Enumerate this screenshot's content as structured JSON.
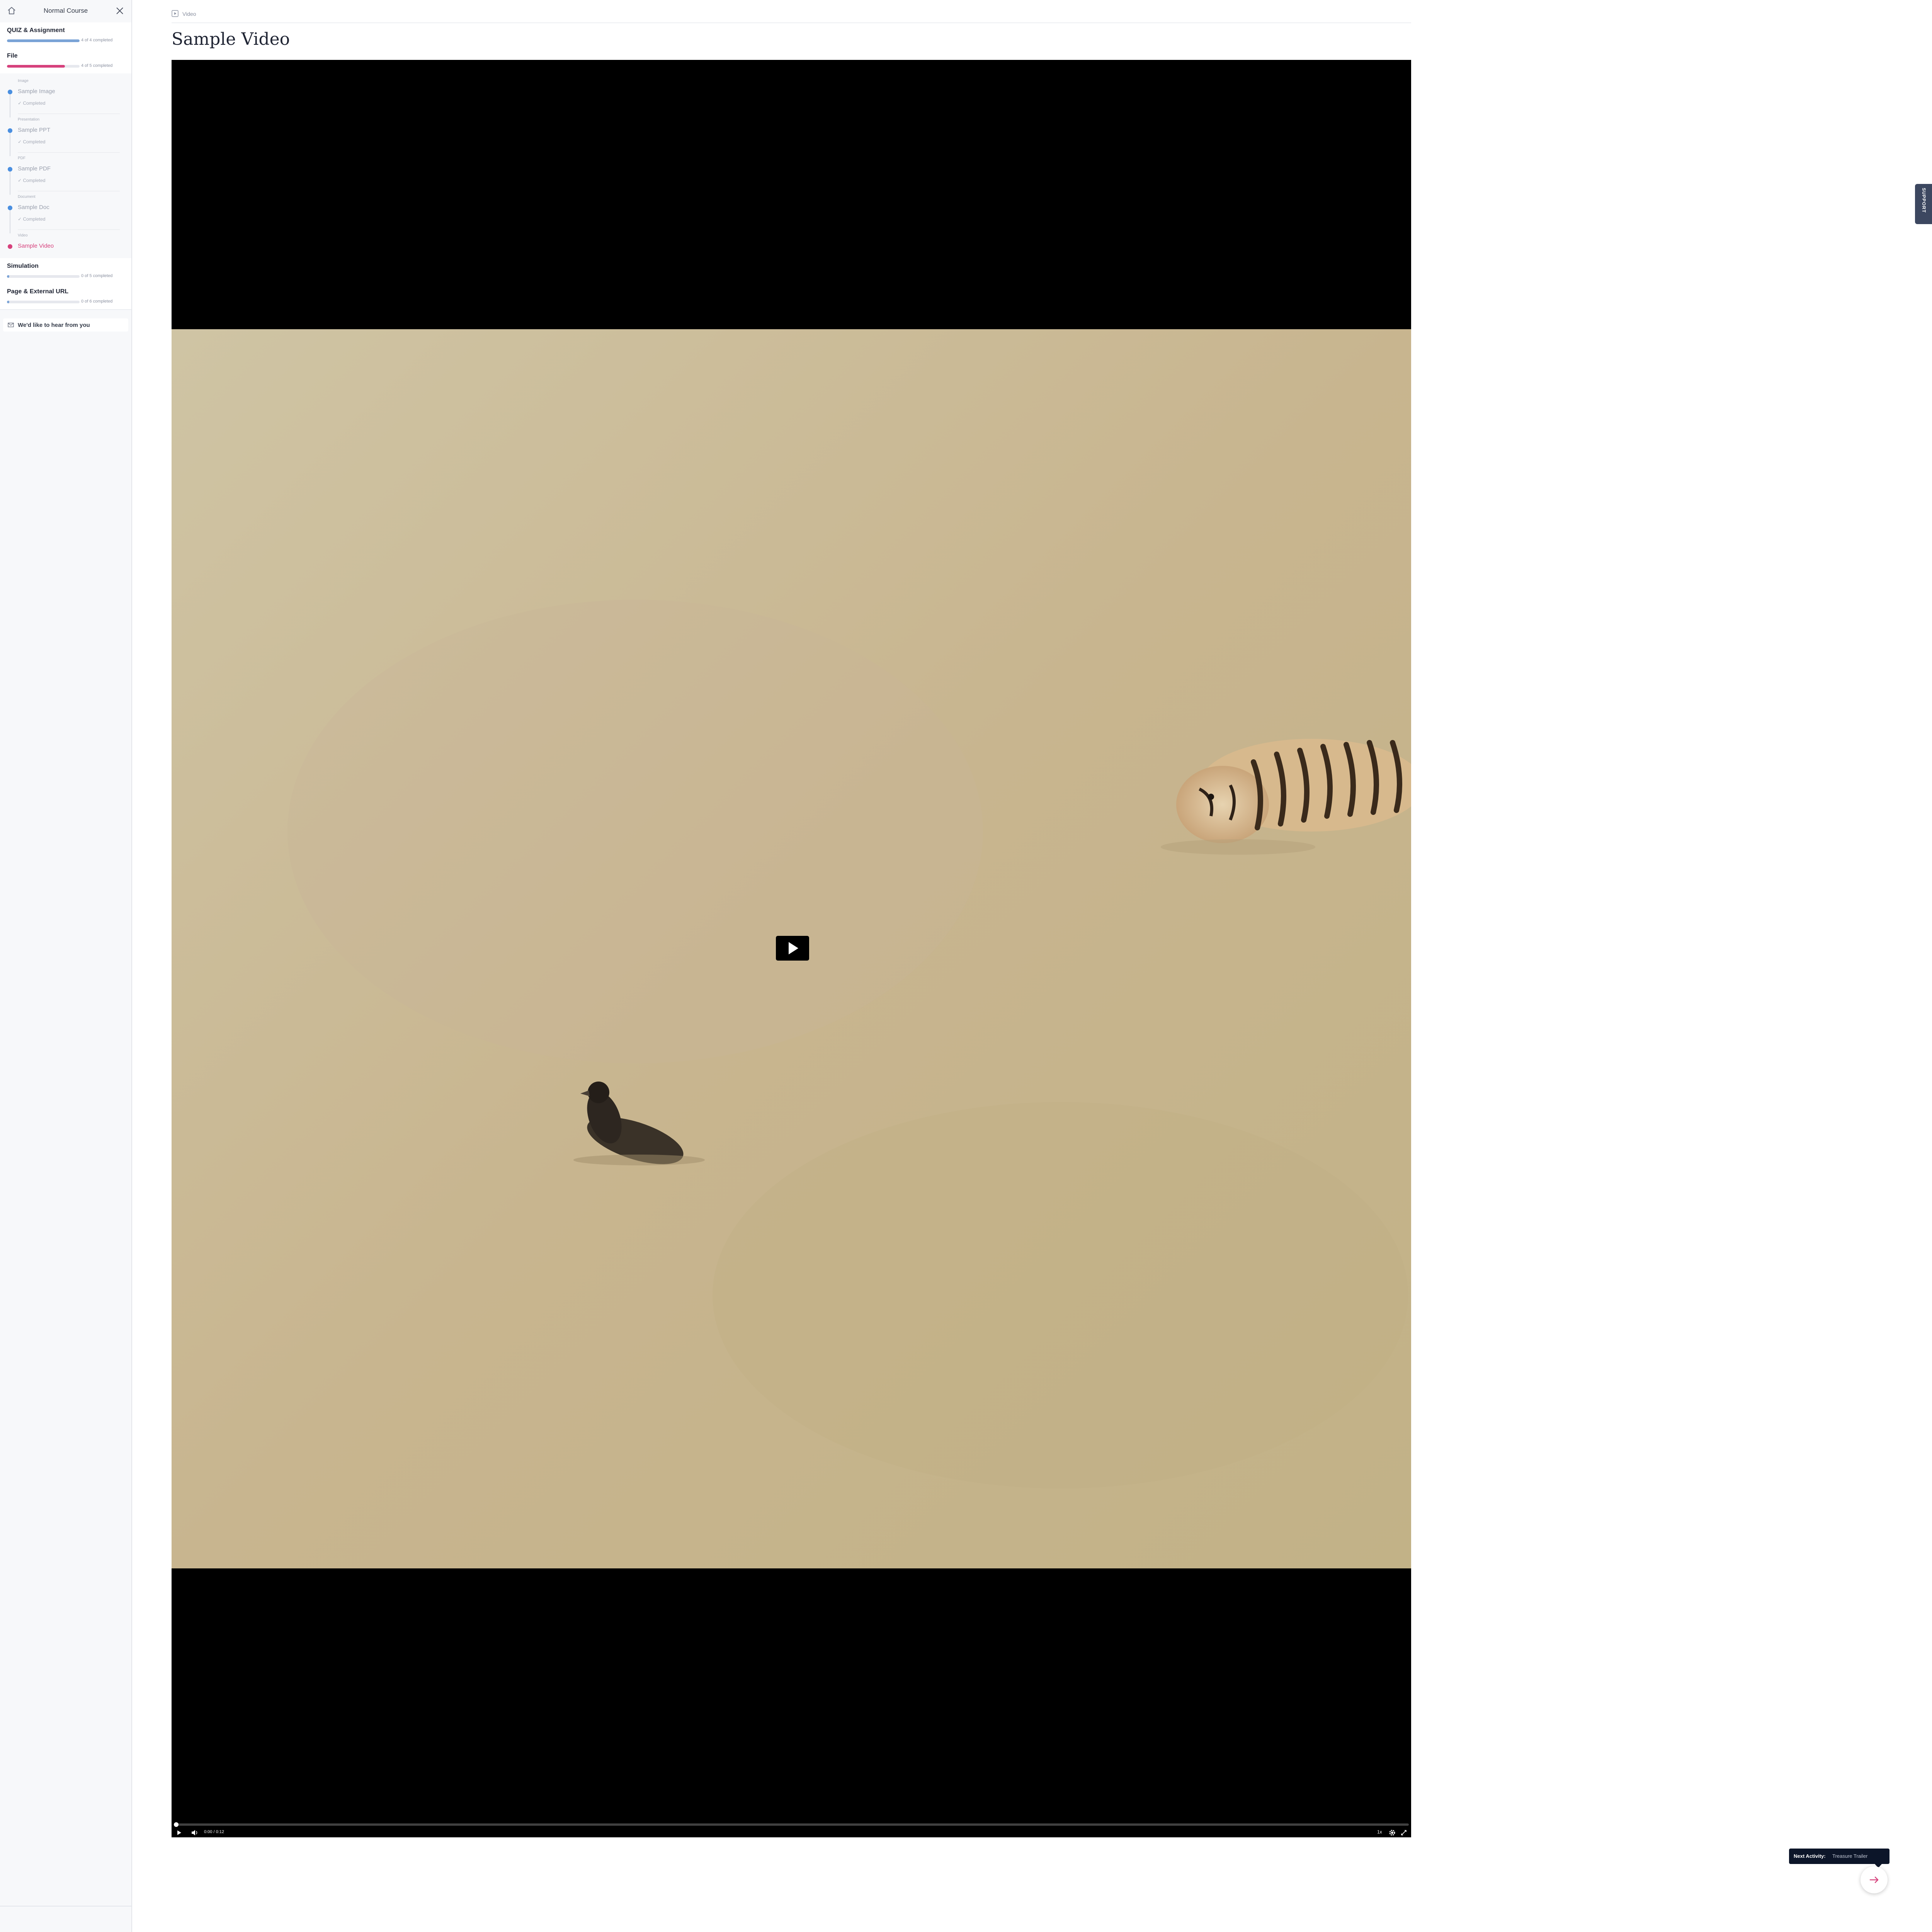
{
  "sidebar": {
    "course_title": "Normal Course",
    "sections": [
      {
        "title": "QUIZ & Assignment",
        "count": "4 of 4 completed",
        "progress": 1.0,
        "color": "#7aa3d6"
      },
      {
        "title": "File",
        "count": "4 of 5 completed",
        "progress": 0.8,
        "color": "#d6417c"
      },
      {
        "title": "Simulation",
        "count": "0 of 5 completed",
        "progress": 0.0,
        "color": "#7aa3d6"
      },
      {
        "title": "Page & External URL",
        "count": "0 of 6 completed",
        "progress": 0.0,
        "color": "#7aa3d6"
      }
    ],
    "file_items": [
      {
        "type": "Image",
        "title": "Sample Image",
        "status": "✓ Completed"
      },
      {
        "type": "Presentation",
        "title": "Sample PPT",
        "status": "✓ Completed"
      },
      {
        "type": "PDF",
        "title": "Sample PDF",
        "status": "✓ Completed"
      },
      {
        "type": "Document",
        "title": "Sample Doc",
        "status": "✓ Completed"
      },
      {
        "type": "Video",
        "title": "Sample Video",
        "status": ""
      }
    ],
    "feedback_label": "We'd like to hear from you"
  },
  "main": {
    "breadcrumb": "Video",
    "page_title": "Sample Video"
  },
  "player": {
    "time": "0:00 / 0:12",
    "speed": "1x",
    "progress": 0.0
  },
  "support_label": "SUPPORT",
  "next_activity": {
    "label": "Next Activity:",
    "title": "Treasure Trailer"
  },
  "colors": {
    "accent_pink": "#d6417c",
    "accent_blue": "#4a8fe0",
    "dark_navy": "#0c1529"
  }
}
